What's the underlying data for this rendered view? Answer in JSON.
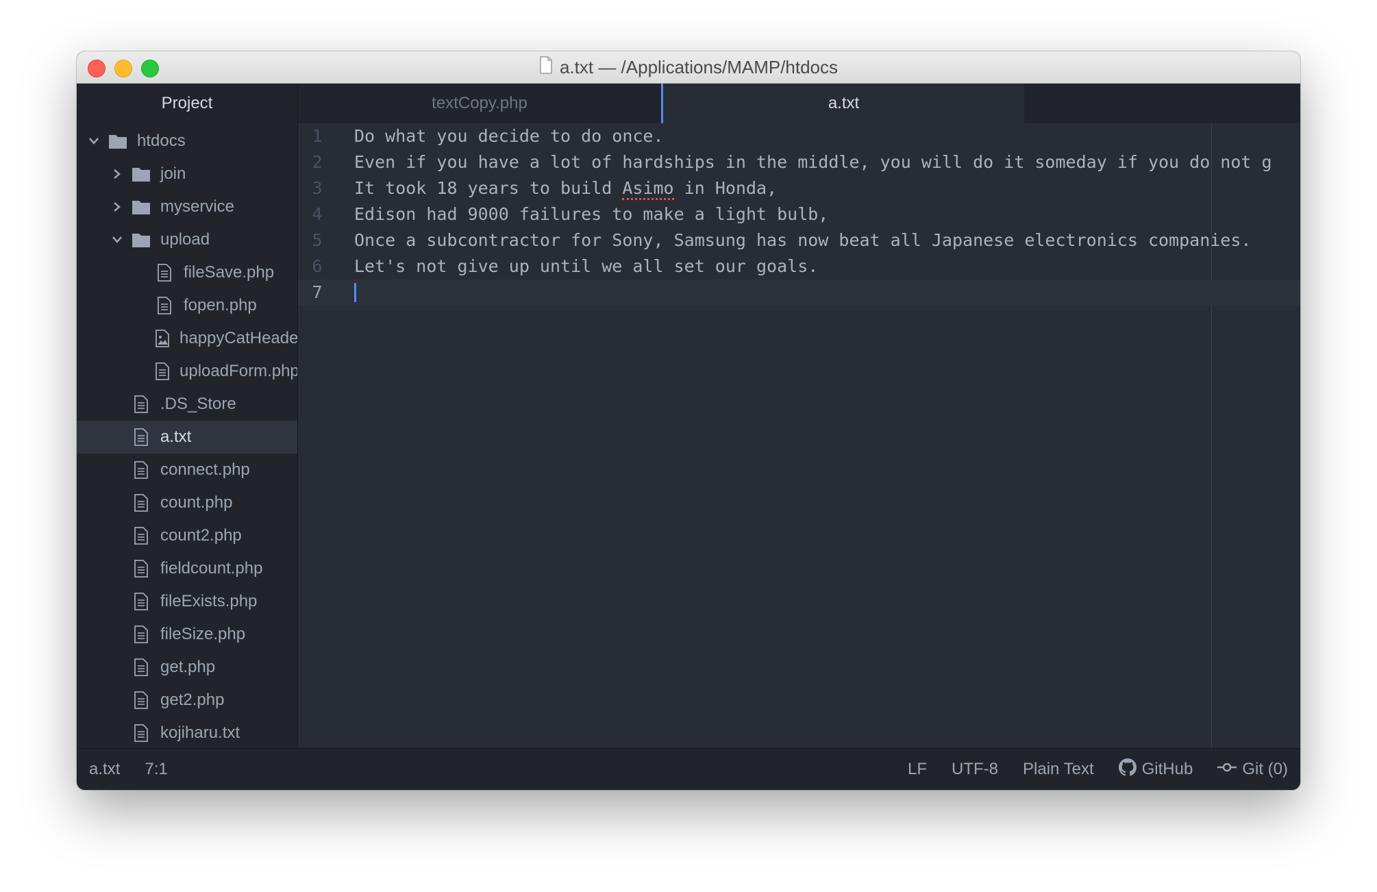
{
  "window": {
    "title": "a.txt — /Applications/MAMP/htdocs"
  },
  "sidebar": {
    "header": "Project",
    "items": [
      {
        "label": "htdocs",
        "type": "folder",
        "expanded": true,
        "depth": 0
      },
      {
        "label": "join",
        "type": "folder",
        "expanded": false,
        "depth": 1
      },
      {
        "label": "myservice",
        "type": "folder",
        "expanded": false,
        "depth": 1
      },
      {
        "label": "upload",
        "type": "folder",
        "expanded": true,
        "depth": 1
      },
      {
        "label": "fileSave.php",
        "type": "file",
        "depth": 2
      },
      {
        "label": "fopen.php",
        "type": "file",
        "depth": 2
      },
      {
        "label": "happyCatHeade",
        "type": "image",
        "depth": 2
      },
      {
        "label": "uploadForm.php",
        "type": "file",
        "depth": 2
      },
      {
        "label": ".DS_Store",
        "type": "file",
        "depth": 1
      },
      {
        "label": "a.txt",
        "type": "file",
        "depth": 1,
        "selected": true
      },
      {
        "label": "connect.php",
        "type": "file",
        "depth": 1
      },
      {
        "label": "count.php",
        "type": "file",
        "depth": 1
      },
      {
        "label": "count2.php",
        "type": "file",
        "depth": 1
      },
      {
        "label": "fieldcount.php",
        "type": "file",
        "depth": 1
      },
      {
        "label": "fileExists.php",
        "type": "file",
        "depth": 1
      },
      {
        "label": "fileSize.php",
        "type": "file",
        "depth": 1
      },
      {
        "label": "get.php",
        "type": "file",
        "depth": 1
      },
      {
        "label": "get2.php",
        "type": "file",
        "depth": 1
      },
      {
        "label": "kojiharu.txt",
        "type": "file",
        "depth": 1
      }
    ]
  },
  "tabs": [
    {
      "label": "textCopy.php",
      "active": false
    },
    {
      "label": "a.txt",
      "active": true
    }
  ],
  "editor": {
    "lines": [
      {
        "num": "1",
        "text": "Do what you decide to do once."
      },
      {
        "num": "2",
        "text": "Even if you have a lot of hardships in the middle, you will do it someday if you do not g"
      },
      {
        "num": "3",
        "pre": "It took 18 years to build ",
        "misspelled": "Asimo",
        "post": " in Honda,"
      },
      {
        "num": "4",
        "text": "Edison had 9000 failures to make a light bulb,"
      },
      {
        "num": "5",
        "text": "Once a subcontractor for Sony, Samsung has now beat all Japanese electronics companies."
      },
      {
        "num": "6",
        "text": "Let's not give up until we all set our goals."
      },
      {
        "num": "7",
        "text": ""
      }
    ],
    "current_line": 7
  },
  "status": {
    "file": "a.txt",
    "cursor": "7:1",
    "line_ending": "LF",
    "encoding": "UTF-8",
    "grammar": "Plain Text",
    "github": "GitHub",
    "git": "Git (0)"
  },
  "colors": {
    "accent": "#568af2",
    "traffic_close": "#fe5f57",
    "traffic_min": "#febc2e",
    "traffic_max": "#28c840",
    "misspelling": "#e05252"
  }
}
